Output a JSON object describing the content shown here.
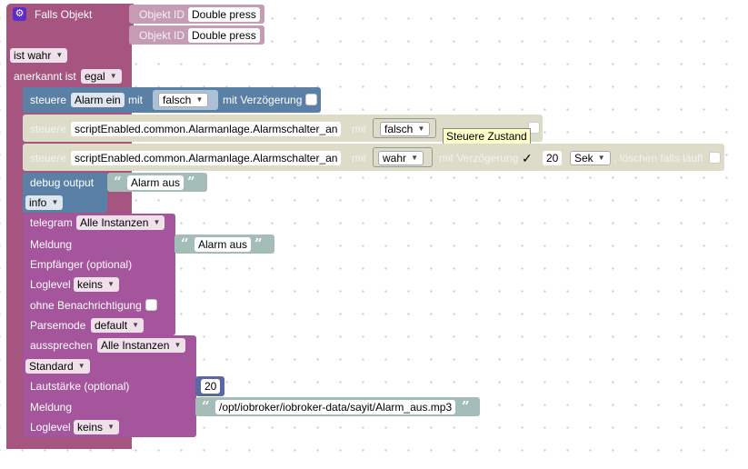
{
  "trigger": {
    "header": "Falls Objekt",
    "object_id_label": "Objekt ID",
    "object_ids": [
      "Double press",
      "Double press"
    ],
    "condition": "ist wahr",
    "ack_label": "anerkannt ist",
    "ack_value": "egal"
  },
  "set_alarm": {
    "label": "steuere",
    "target": "Alarm ein",
    "with_label": "mit",
    "value": "falsch",
    "delay_label": "mit Verzögerung"
  },
  "set_switch1": {
    "label": "steuere",
    "target": "scriptEnabled.common.Alarmanlage.Alarmschalter_an",
    "with_label": "mit",
    "value": "falsch",
    "tooltip": "Steuere Zustand"
  },
  "set_switch2": {
    "label": "steuere",
    "target": "scriptEnabled.common.Alarmanlage.Alarmschalter_an",
    "with_label": "mit",
    "value": "wahr",
    "delay_label": "mit Verzögerung",
    "delay_check": "✓",
    "delay_value": "20",
    "delay_unit": "Sek",
    "clear_label": ", löschen falls läuft"
  },
  "debug": {
    "label": "debug output",
    "text": "Alarm aus",
    "level": "info"
  },
  "telegram": {
    "label": "telegram",
    "instance": "Alle Instanzen",
    "message_label": "Meldung",
    "message": "Alarm aus",
    "recipient_label": "Empfänger (optional)",
    "loglevel_label": "Loglevel",
    "loglevel": "keins",
    "silent_label": "ohne Benachrichtigung",
    "parsemode_label": "Parsemode",
    "parsemode": "default"
  },
  "speak": {
    "label": "aussprechen",
    "instance": "Alle Instanzen",
    "mode": "Standard",
    "volume_label": "Lautstärke (optional)",
    "volume": "20",
    "message_label": "Meldung",
    "message": "/opt/iobroker/iobroker-data/sayit/Alarm_aus.mp3",
    "loglevel_label": "Loglevel",
    "loglevel": "keins"
  },
  "colors": {
    "trigger": "#a5557f",
    "control": "#5b80a5",
    "disabled": "#dcdcc8",
    "message": "#a5559b",
    "text": "#a5bdb8",
    "number": "#5b67a5"
  }
}
